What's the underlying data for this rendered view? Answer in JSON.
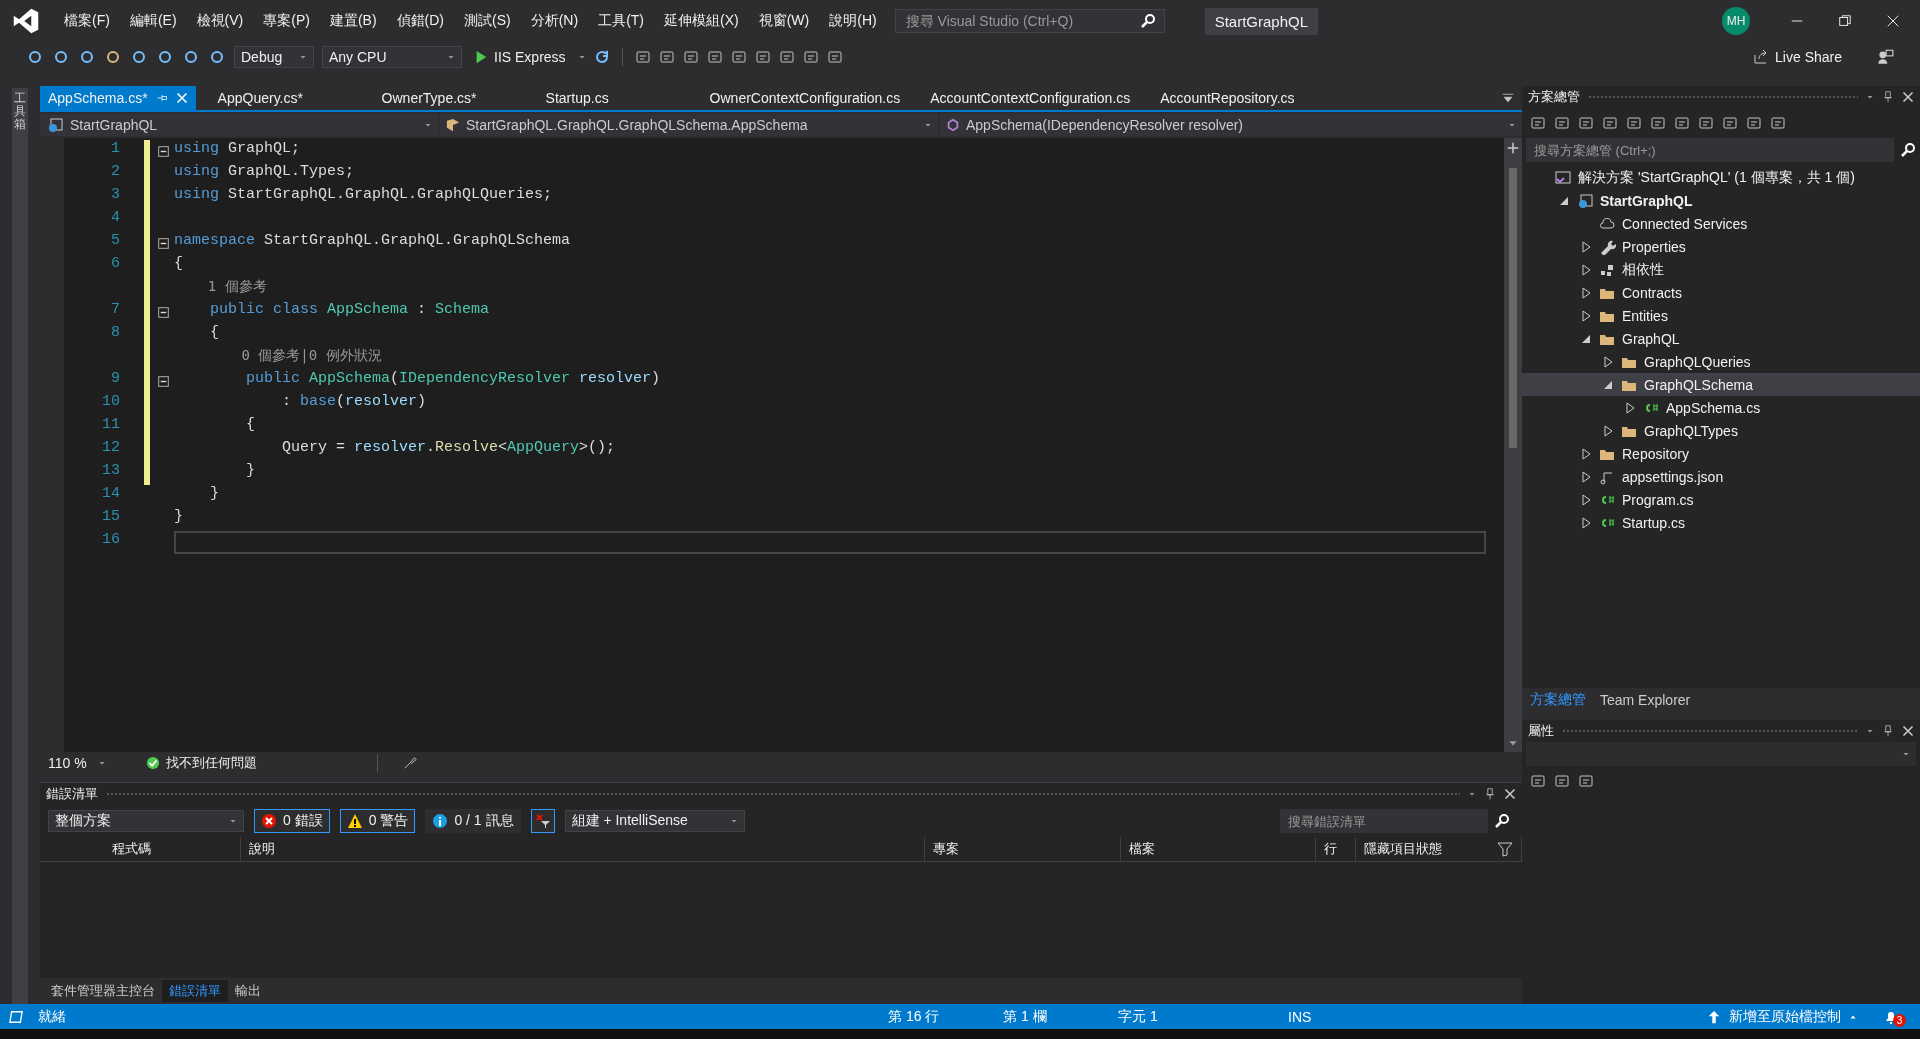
{
  "menu": [
    "檔案(F)",
    "編輯(E)",
    "檢視(V)",
    "專案(P)",
    "建置(B)",
    "偵錯(D)",
    "測試(S)",
    "分析(N)",
    "工具(T)",
    "延伸模組(X)",
    "視窗(W)",
    "說明(H)"
  ],
  "search": {
    "placeholder": "搜尋 Visual Studio (Ctrl+Q)"
  },
  "solution_name": "StartGraphQL",
  "avatar": "MH",
  "toolbar": {
    "configuration": "Debug",
    "platform": "Any CPU",
    "run": "IIS Express",
    "live_share": "Live Share"
  },
  "left_strip": "工具箱",
  "tabs": [
    {
      "label": "AppSchema.cs*",
      "selected": true
    },
    {
      "label": "AppQuery.cs*",
      "selected": false
    },
    {
      "label": "OwnerType.cs*",
      "selected": false
    },
    {
      "label": "Startup.cs",
      "selected": false
    },
    {
      "label": "OwnerContextConfiguration.cs",
      "selected": false
    },
    {
      "label": "AccountContextConfiguration.cs",
      "selected": false
    },
    {
      "label": "AccountRepository.cs",
      "selected": false
    }
  ],
  "nav": {
    "project": "StartGraphQL",
    "type": "StartGraphQL.GraphQL.GraphQLSchema.AppSchema",
    "member": "AppSchema(IDependencyResolver resolver)"
  },
  "code": [
    {
      "number": "1",
      "fold": true,
      "tokens": [
        {
          "text": "using",
          "kind": "keyword"
        },
        {
          "text": " GraphQL;",
          "kind": "plain"
        }
      ]
    },
    {
      "number": "2",
      "tokens": [
        {
          "text": "using",
          "kind": "keyword"
        },
        {
          "text": " GraphQL.Types;",
          "kind": "plain"
        }
      ]
    },
    {
      "number": "3",
      "tokens": [
        {
          "text": "using",
          "kind": "keyword"
        },
        {
          "text": " StartGraphQL.GraphQL.GraphQLQueries;",
          "kind": "plain"
        }
      ]
    },
    {
      "number": "4"
    },
    {
      "number": "5",
      "fold": true,
      "tokens": [
        {
          "text": "namespace",
          "kind": "keyword"
        },
        {
          "text": " StartGraphQL.GraphQL.GraphQLSchema",
          "kind": "plain"
        }
      ]
    },
    {
      "number": "6",
      "tokens": [
        {
          "text": "{",
          "kind": "plain"
        }
      ]
    },
    {
      "lens": "    1 個參考"
    },
    {
      "number": "7",
      "fold": true,
      "tokens": [
        {
          "text": "    public class ",
          "kind": "keyword"
        },
        {
          "text": "AppSchema",
          "kind": "type"
        },
        {
          "text": " : ",
          "kind": "plain"
        },
        {
          "text": "Schema",
          "kind": "type"
        }
      ]
    },
    {
      "number": "8",
      "tokens": [
        {
          "text": "    {",
          "kind": "plain"
        }
      ]
    },
    {
      "lens": "        0 個參考|0 例外狀況"
    },
    {
      "number": "9",
      "fold": true,
      "tokens": [
        {
          "text": "        public ",
          "kind": "keyword"
        },
        {
          "text": "AppSchema",
          "kind": "type"
        },
        {
          "text": "(",
          "kind": "plain"
        },
        {
          "text": "IDependencyResolver",
          "kind": "type"
        },
        {
          "text": " resolver",
          "kind": "variable"
        },
        {
          "text": ")",
          "kind": "plain"
        }
      ]
    },
    {
      "number": "10",
      "tokens": [
        {
          "text": "            : ",
          "kind": "plain"
        },
        {
          "text": "base",
          "kind": "keyword"
        },
        {
          "text": "(",
          "kind": "plain"
        },
        {
          "text": "resolver",
          "kind": "variable"
        },
        {
          "text": ")",
          "kind": "plain"
        }
      ]
    },
    {
      "number": "11",
      "tokens": [
        {
          "text": "        {",
          "kind": "plain"
        }
      ]
    },
    {
      "number": "12",
      "tokens": [
        {
          "text": "            Query = ",
          "kind": "plain"
        },
        {
          "text": "resolver",
          "kind": "variable"
        },
        {
          "text": ".",
          "kind": "plain"
        },
        {
          "text": "Resolve",
          "kind": "method"
        },
        {
          "text": "<",
          "kind": "plain"
        },
        {
          "text": "AppQuery",
          "kind": "type"
        },
        {
          "text": ">();",
          "kind": "plain"
        }
      ]
    },
    {
      "number": "13",
      "tokens": [
        {
          "text": "        }",
          "kind": "plain"
        }
      ]
    },
    {
      "number": "14",
      "tokens": [
        {
          "text": "    }",
          "kind": "plain"
        }
      ]
    },
    {
      "number": "15",
      "tokens": [
        {
          "text": "}",
          "kind": "plain"
        }
      ]
    },
    {
      "number": "16",
      "current": true
    }
  ],
  "editor_footer": {
    "zoom": "110 %",
    "issues": "找不到任何問題"
  },
  "error_list": {
    "title": "錯誤清單",
    "scope": "整個方案",
    "errors": "0 錯誤",
    "warnings": "0 警告",
    "messages": "0 / 1 訊息",
    "source": "組建 + IntelliSense",
    "search_placeholder": "搜尋錯誤清單",
    "columns": [
      "程式碼",
      "說明",
      "專案",
      "檔案",
      "行",
      "隱藏項目狀態"
    ]
  },
  "bottom_tabs": [
    {
      "label": "套件管理器主控台",
      "selected": false
    },
    {
      "label": "錯誤清單",
      "selected": true
    },
    {
      "label": "輸出",
      "selected": false
    }
  ],
  "solution_explorer": {
    "title": "方案總管",
    "search_placeholder": "搜尋方案總管 (Ctrl+;)",
    "tree": [
      {
        "label": "解決方案 'StartGraphQL' (1 個專案，共 1 個)",
        "kind": "solution",
        "selected": false,
        "children": [
          {
            "label": "StartGraphQL",
            "kind": "project",
            "expanded": true,
            "selected": false,
            "children": [
              {
                "label": "Connected Services",
                "kind": "cloud",
                "selected": false
              },
              {
                "label": "Properties",
                "kind": "wrench",
                "expanded": false,
                "selected": false
              },
              {
                "label": "相依性",
                "kind": "deps",
                "expanded": false,
                "selected": false
              },
              {
                "label": "Contracts",
                "kind": "folder",
                "expanded": false,
                "selected": false
              },
              {
                "label": "Entities",
                "kind": "folder",
                "expanded": false,
                "selected": false
              },
              {
                "label": "GraphQL",
                "kind": "folder",
                "expanded": true,
                "selected": false,
                "children": [
                  {
                    "label": "GraphQLQueries",
                    "kind": "folder",
                    "expanded": false,
                    "selected": false
                  },
                  {
                    "label": "GraphQLSchema",
                    "kind": "folder",
                    "expanded": true,
                    "selected": true,
                    "children": [
                      {
                        "label": "AppSchema.cs",
                        "kind": "cs",
                        "expanded": false,
                        "selected": false
                      }
                    ]
                  },
                  {
                    "label": "GraphQLTypes",
                    "kind": "folder",
                    "expanded": false,
                    "selected": false
                  }
                ]
              },
              {
                "label": "Repository",
                "kind": "folder",
                "expanded": false,
                "selected": false
              },
              {
                "label": "appsettings.json",
                "kind": "json",
                "expanded": false,
                "selected": false
              },
              {
                "label": "Program.cs",
                "kind": "cs",
                "expanded": false,
                "selected": false
              },
              {
                "label": "Startup.cs",
                "kind": "cs",
                "expanded": false,
                "selected": false
              }
            ]
          }
        ]
      }
    ]
  },
  "panel_tabs": [
    {
      "label": "方案總管",
      "selected": true
    },
    {
      "label": "Team Explorer",
      "selected": false
    }
  ],
  "properties": {
    "title": "屬性"
  },
  "status_bar": {
    "state": "就緒",
    "line": "第 16 行",
    "column": "第 1 欄",
    "char": "字元 1",
    "mode": "INS",
    "source_control": "新增至原始檔控制",
    "notifications": "3"
  }
}
